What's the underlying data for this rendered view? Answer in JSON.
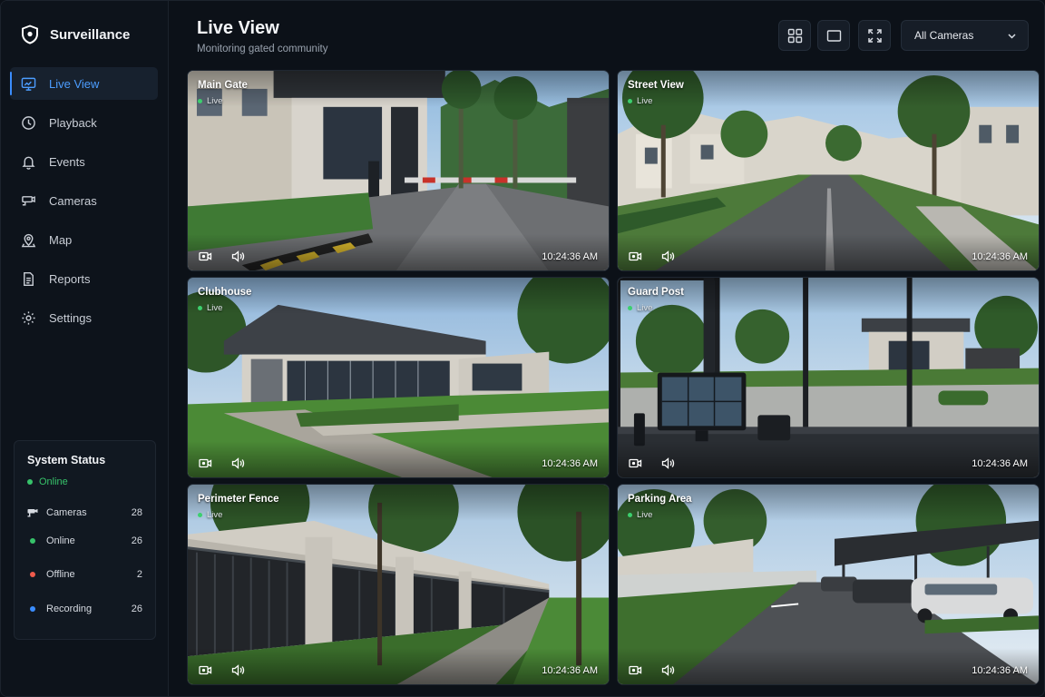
{
  "app": {
    "name": "Surveillance"
  },
  "sidebar": {
    "items": [
      {
        "label": "Live View",
        "icon": "monitor-icon",
        "active": true
      },
      {
        "label": "Playback",
        "icon": "clock-icon",
        "active": false
      },
      {
        "label": "Events",
        "icon": "bell-icon",
        "active": false
      },
      {
        "label": "Cameras",
        "icon": "cctv-camera-icon",
        "active": false
      },
      {
        "label": "Map",
        "icon": "map-pin-icon",
        "active": false
      },
      {
        "label": "Reports",
        "icon": "document-icon",
        "active": false
      },
      {
        "label": "Settings",
        "icon": "gear-icon",
        "active": false
      }
    ]
  },
  "system_status": {
    "title": "System Status",
    "state": "Online",
    "rows": [
      {
        "label": "Cameras",
        "value": "28",
        "icon": "cctv-camera-icon"
      },
      {
        "label": "Online",
        "value": "26",
        "color": "#37c26a"
      },
      {
        "label": "Offline",
        "value": "2",
        "color": "#ef5a4c"
      },
      {
        "label": "Recording",
        "value": "26",
        "color": "#3b8dff"
      }
    ]
  },
  "header": {
    "title": "Live View",
    "subtitle": "Monitoring gated community",
    "camera_filter": "All Cameras"
  },
  "cameras": [
    {
      "name": "Main Gate",
      "status": "Live",
      "time": "10:24:36 AM"
    },
    {
      "name": "Street View",
      "status": "Live",
      "time": "10:24:36 AM"
    },
    {
      "name": "Clubhouse",
      "status": "Live",
      "time": "10:24:36 AM"
    },
    {
      "name": "Guard Post",
      "status": "Live",
      "time": "10:24:36 AM"
    },
    {
      "name": "Perimeter Fence",
      "status": "Live",
      "time": "10:24:36 AM"
    },
    {
      "name": "Parking Area",
      "status": "Live",
      "time": "10:24:36 AM"
    }
  ],
  "colors": {
    "accent": "#3b8dff",
    "online": "#37c26a",
    "offline": "#ef5a4c",
    "recording": "#3b8dff"
  }
}
